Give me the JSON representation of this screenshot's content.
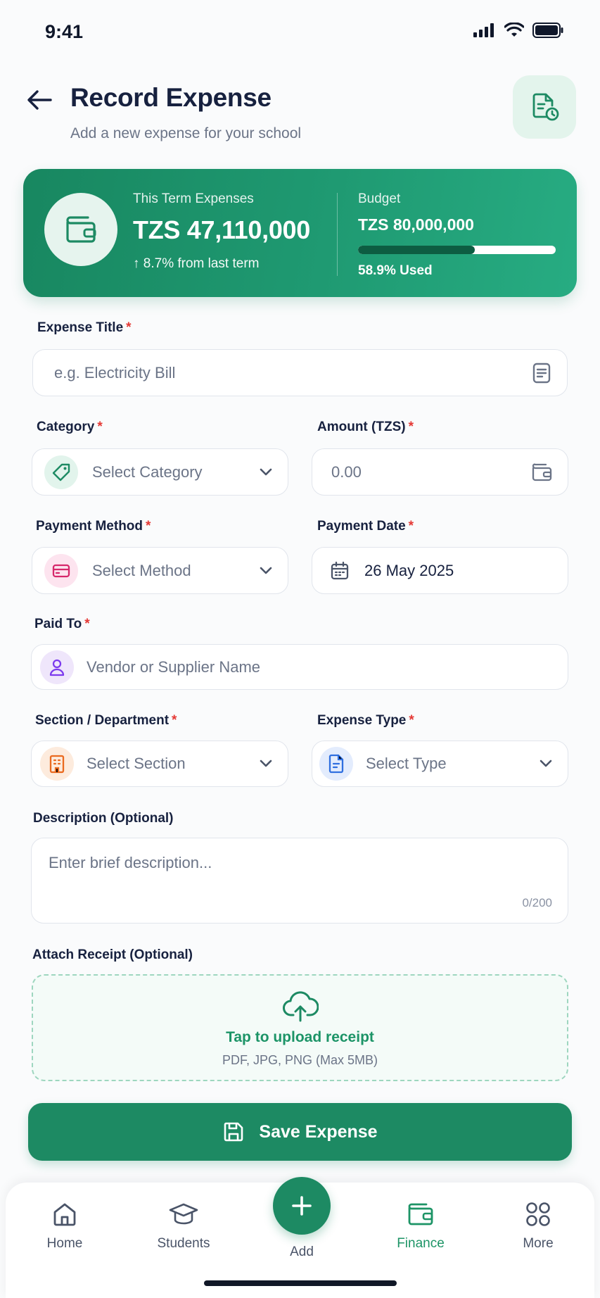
{
  "status_bar": {
    "time": "9:41"
  },
  "header": {
    "title": "Record Expense",
    "subtitle": "Add a new expense for your school"
  },
  "summary": {
    "expenses_label": "This Term Expenses",
    "expenses_amount": "TZS 47,110,000",
    "change_text": "↑ 8.7% from last term",
    "budget_label": "Budget",
    "budget_amount": "TZS 80,000,000",
    "budget_used_fraction": 0.589,
    "budget_used_text": "58.9% Used"
  },
  "form": {
    "expense_title": {
      "label": "Expense Title",
      "required": "*",
      "placeholder": "e.g. Electricity Bill"
    },
    "category": {
      "label": "Category",
      "required": "*",
      "placeholder": "Select Category"
    },
    "amount": {
      "label": "Amount (TZS)",
      "required": "*",
      "placeholder": "0.00"
    },
    "payment_method": {
      "label": "Payment Method",
      "required": "*",
      "placeholder": "Select Method"
    },
    "payment_date": {
      "label": "Payment Date",
      "required": "*",
      "value": "26 May 2025"
    },
    "paid_to": {
      "label": "Paid To",
      "required": "*",
      "placeholder": "Vendor or Supplier Name"
    },
    "section": {
      "label": "Section / Department",
      "required": "*",
      "placeholder": "Select Section"
    },
    "expense_type": {
      "label": "Expense Type",
      "required": "*",
      "placeholder": "Select Type"
    },
    "description": {
      "label": "Description (Optional)",
      "placeholder": "Enter brief description...",
      "counter": "0/200"
    },
    "receipt": {
      "label": "Attach Receipt (Optional)",
      "title": "Tap to upload receipt",
      "hint": "PDF, JPG, PNG (Max 5MB)"
    }
  },
  "save_button": {
    "label": "Save Expense"
  },
  "nav": {
    "items": [
      {
        "label": "Home",
        "icon": "home-icon"
      },
      {
        "label": "Students",
        "icon": "graduation-cap-icon"
      },
      {
        "label": "Add",
        "icon": "plus-icon"
      },
      {
        "label": "Finance",
        "icon": "wallet-icon",
        "active": true
      },
      {
        "label": "More",
        "icon": "grid-icon"
      }
    ]
  },
  "colors": {
    "primary": "#1d8a63",
    "required": "#e53935",
    "title": "#17213f"
  }
}
